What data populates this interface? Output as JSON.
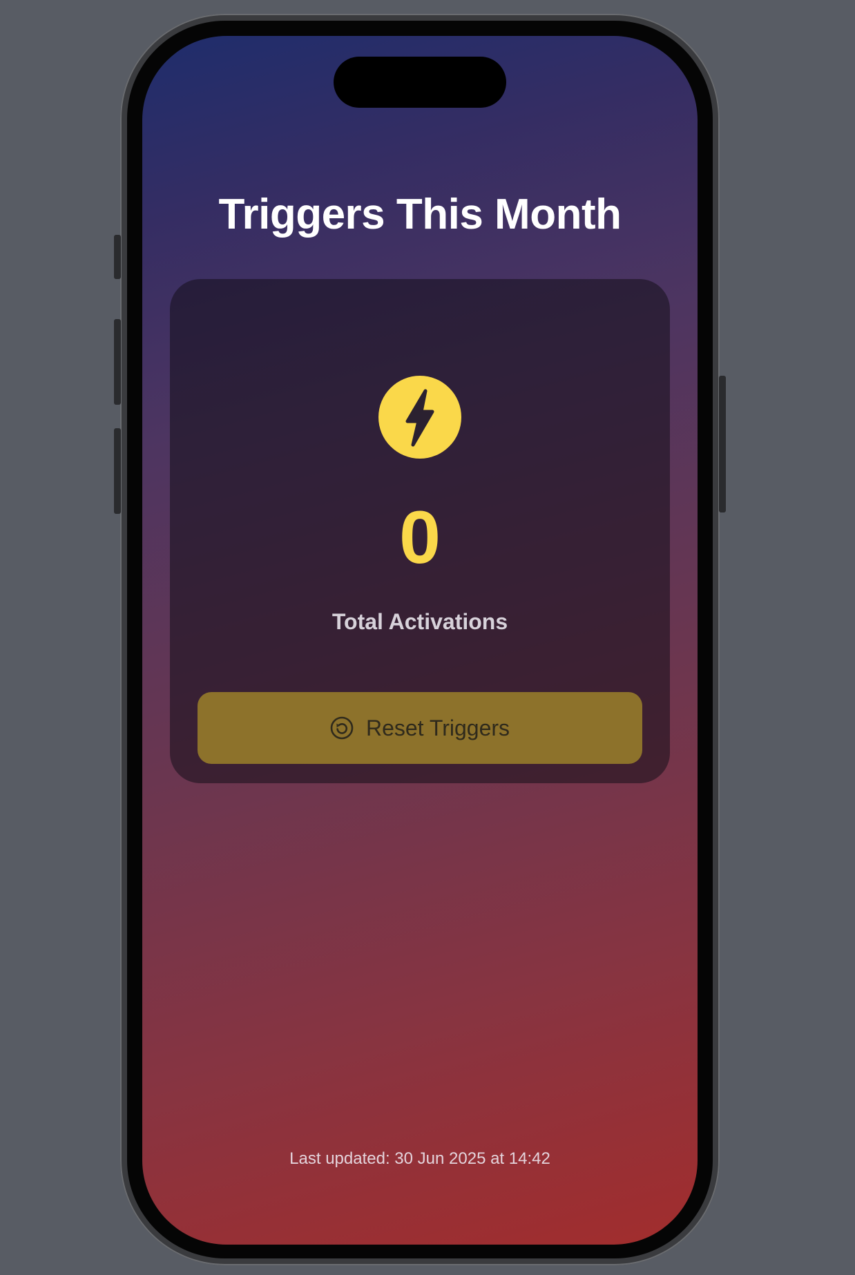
{
  "screen": {
    "title": "Triggers This Month",
    "last_updated": "Last updated: 30 Jun 2025 at 14:42"
  },
  "card": {
    "badge_icon": "lightning-bolt-icon",
    "count": "0",
    "count_label": "Total Activations",
    "reset_button": {
      "icon": "arrow-counterclockwise-circle-icon",
      "label": "Reset Triggers"
    }
  },
  "colors": {
    "accent": "#fad84a",
    "button_bg": "#8d722b",
    "gradient_top": "#1f2d6c",
    "gradient_bottom": "#a22d2d"
  }
}
